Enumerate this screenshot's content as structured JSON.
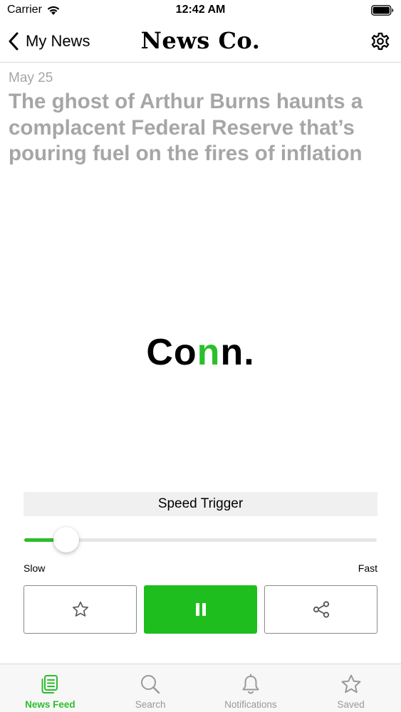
{
  "status_bar": {
    "carrier": "Carrier",
    "time": "12:42 AM"
  },
  "nav": {
    "back_label": "My News",
    "brand": "News Co."
  },
  "article": {
    "date": "May 25",
    "headline": "The ghost of Arthur Burns haunts a complacent Federal Reserve that’s pouring fuel on the fires of inflation"
  },
  "reader": {
    "word_prefix": "Co",
    "word_focus": "n",
    "word_suffix": "n."
  },
  "speed": {
    "title": "Speed Trigger",
    "slow_label": "Slow",
    "fast_label": "Fast",
    "value": 0.12
  },
  "colors": {
    "accent": "#2bbf2b",
    "muted_text": "#a6a6a6"
  },
  "tabs": [
    {
      "label": "News Feed",
      "icon": "news-feed-icon",
      "active": true
    },
    {
      "label": "Search",
      "icon": "search-icon",
      "active": false
    },
    {
      "label": "Notifications",
      "icon": "bell-icon",
      "active": false
    },
    {
      "label": "Saved",
      "icon": "star-icon",
      "active": false
    }
  ]
}
